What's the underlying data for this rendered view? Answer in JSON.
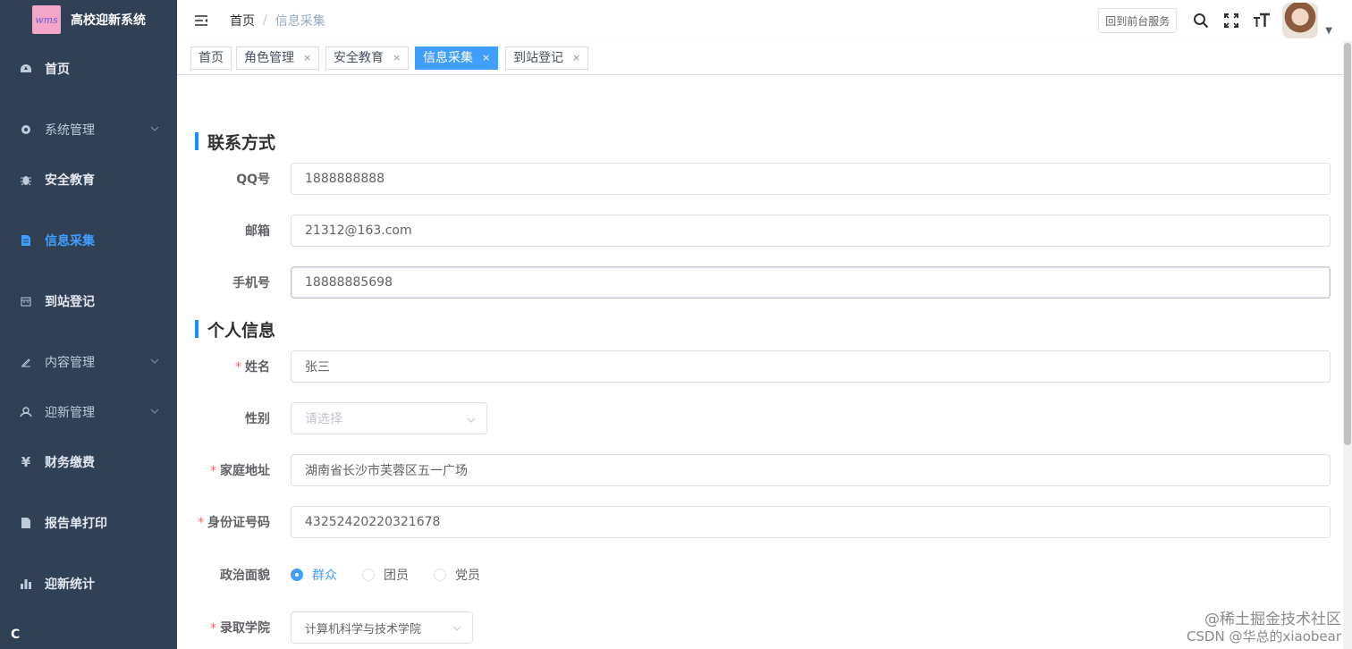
{
  "app": {
    "logo_text": "wms",
    "title": "高校迎新系统"
  },
  "sidebar": {
    "items": [
      {
        "label": "首页",
        "icon": "dashboard-icon",
        "active": false,
        "expandable": false,
        "bold": true
      },
      {
        "label": "系统管理",
        "icon": "gear-icon",
        "active": false,
        "expandable": true,
        "bold": false
      },
      {
        "label": "安全教育",
        "icon": "bug-icon",
        "active": false,
        "expandable": false,
        "bold": true
      },
      {
        "label": "信息采集",
        "icon": "document-icon",
        "active": true,
        "expandable": false,
        "bold": true
      },
      {
        "label": "到站登记",
        "icon": "calendar-icon",
        "active": false,
        "expandable": false,
        "bold": true
      },
      {
        "label": "内容管理",
        "icon": "edit-icon",
        "active": false,
        "expandable": true,
        "bold": false
      },
      {
        "label": "迎新管理",
        "icon": "people-icon",
        "active": false,
        "expandable": true,
        "bold": false
      },
      {
        "label": "财务缴费",
        "icon": "yen-icon",
        "active": false,
        "expandable": false,
        "bold": true
      },
      {
        "label": "报告单打印",
        "icon": "print-icon",
        "active": false,
        "expandable": false,
        "bold": true
      },
      {
        "label": "迎新统计",
        "icon": "bar-chart-icon",
        "active": false,
        "expandable": false,
        "bold": true
      }
    ]
  },
  "header": {
    "breadcrumb": [
      "首页",
      "信息采集"
    ],
    "front_button": "回到前台服务",
    "icons": [
      "search-icon",
      "fullscreen-icon",
      "font-size-icon"
    ]
  },
  "tags": [
    {
      "label": "首页",
      "closable": false,
      "active": false
    },
    {
      "label": "角色管理",
      "closable": true,
      "active": false
    },
    {
      "label": "安全教育",
      "closable": true,
      "active": false
    },
    {
      "label": "信息采集",
      "closable": true,
      "active": true
    },
    {
      "label": "到站登记",
      "closable": true,
      "active": false
    }
  ],
  "sections": {
    "contact": "联系方式",
    "personal": "个人信息"
  },
  "form": {
    "qq": {
      "label": "QQ号",
      "value": "1888888888"
    },
    "email": {
      "label": "邮箱",
      "value": "21312@163.com"
    },
    "phone": {
      "label": "手机号",
      "value": "18888885698"
    },
    "name": {
      "label": "姓名",
      "value": "张三",
      "required": true
    },
    "gender": {
      "label": "性别",
      "placeholder": "请选择"
    },
    "address": {
      "label": "家庭地址",
      "value": "湖南省长沙市芙蓉区五一广场",
      "required": true
    },
    "id_number": {
      "label": "身份证号码",
      "value": "43252420220321678",
      "required": true
    },
    "political": {
      "label": "政治面貌",
      "options": [
        "群众",
        "团员",
        "党员"
      ],
      "selected": "群众"
    },
    "college": {
      "label": "录取学院",
      "value": "计算机科学与技术学院",
      "required": true
    }
  },
  "colors": {
    "sidebar_bg": "#304156",
    "accent": "#409eff",
    "required": "#f56c6c"
  },
  "watermark": {
    "line1": "@稀土掘金技术社区",
    "line2": "CSDN @华总的xiaobear"
  }
}
